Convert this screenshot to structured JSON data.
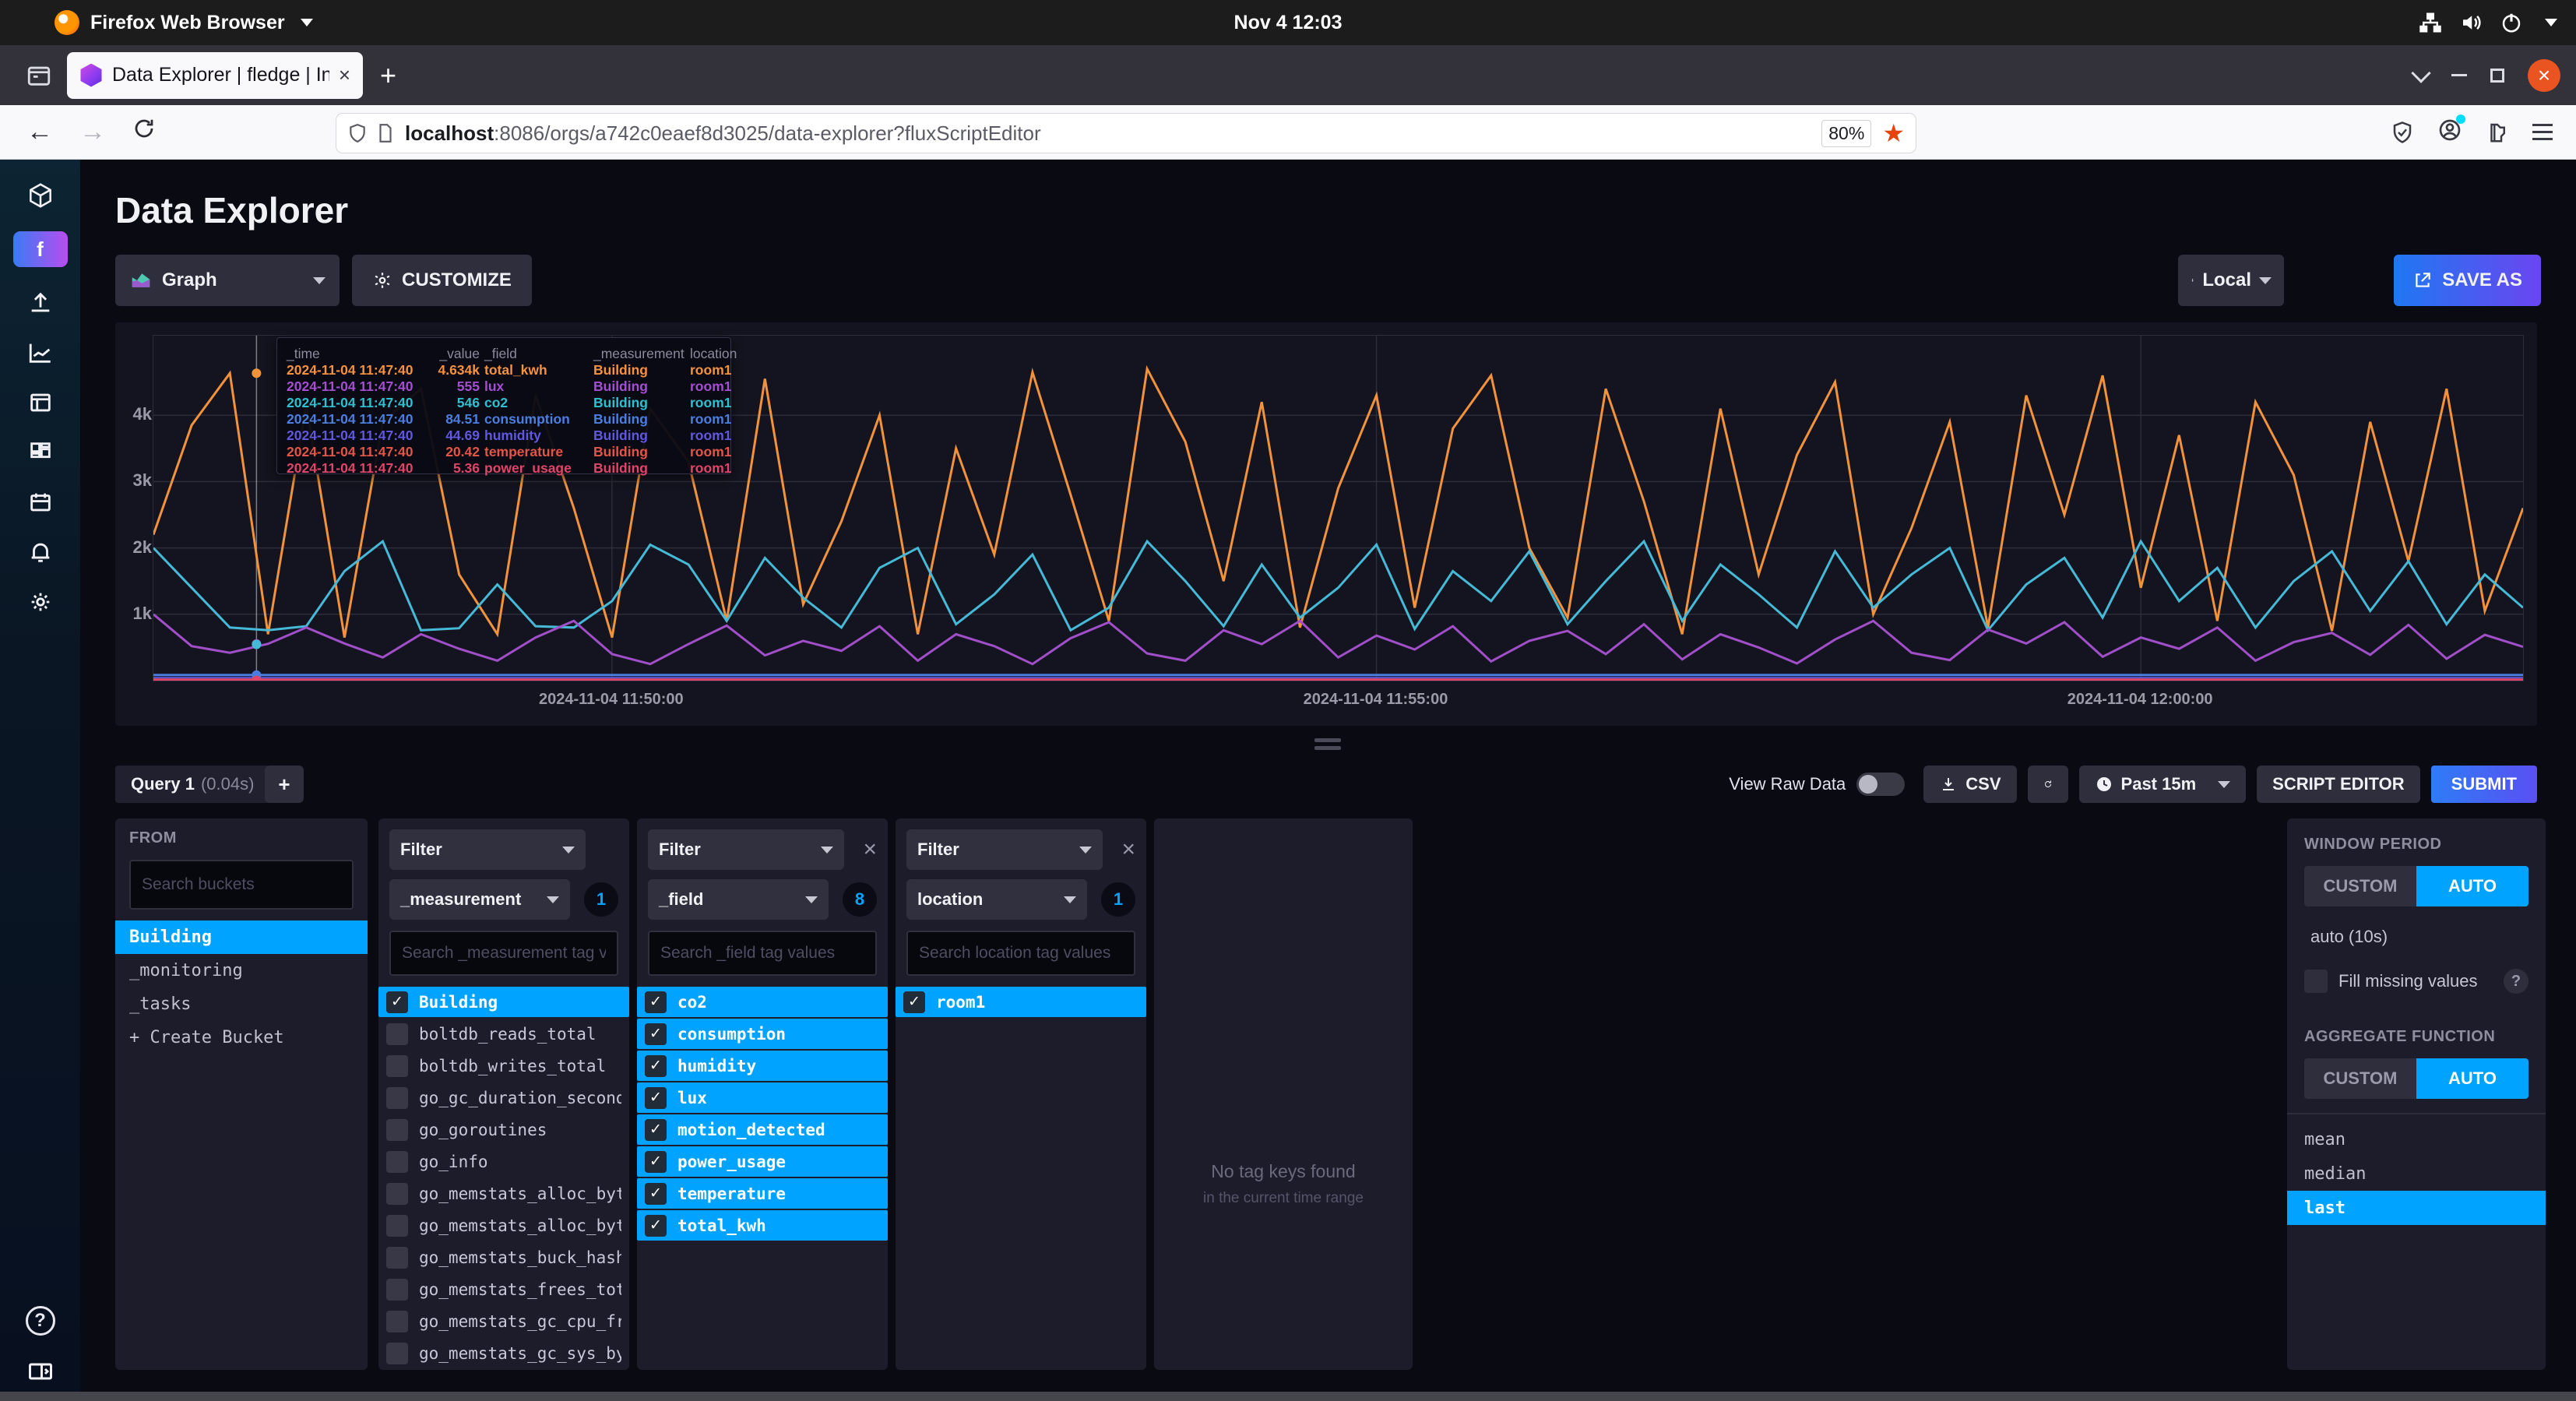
{
  "ubuntu_bar": {
    "app_menu": "Firefox Web Browser",
    "clock": "Nov 4 12:03"
  },
  "browser": {
    "tab_title": "Data Explorer | fledge | In",
    "tab_close": "×",
    "new_tab": "+",
    "close_btn": "×",
    "url_host": "localhost",
    "url_rest": ":8086/orgs/a742c0eaef8d3025/data-explorer?fluxScriptEditor",
    "zoom_level": "80%",
    "star": "★"
  },
  "sidebar": {
    "avatar_label": "f",
    "help_label": "?"
  },
  "header": {
    "title": "Data Explorer",
    "view_type": "Graph",
    "customize_label": "CUSTOMIZE",
    "local_label": "Local",
    "save_as_label": "SAVE AS"
  },
  "chart_data": {
    "type": "line",
    "title": "",
    "xlabel": "",
    "ylabel": "",
    "x_start": "2024-11-04 11:47:00",
    "x_end": "2024-11-04 12:02:30",
    "point_interval_s": 15,
    "ylim": [
      0,
      5200
    ],
    "grid": true,
    "legend": "none",
    "y_ticks": [
      {
        "label": "1k",
        "value": 1000
      },
      {
        "label": "2k",
        "value": 2000
      },
      {
        "label": "3k",
        "value": 3000
      },
      {
        "label": "4k",
        "value": 4000
      }
    ],
    "x_ticks": [
      {
        "label": "2024-11-04 11:50:00",
        "frac": 0.1935
      },
      {
        "label": "2024-11-04 11:55:00",
        "frac": 0.5161
      },
      {
        "label": "2024-11-04 12:00:00",
        "frac": 0.8387
      }
    ],
    "series": [
      {
        "name": "total_kwh",
        "color": "#f2933c",
        "values": [
          2200,
          3850,
          4634,
          700,
          4150,
          650,
          3900,
          4400,
          1600,
          700,
          4300,
          2600,
          650,
          4100,
          3300,
          900,
          4550,
          1150,
          2400,
          4000,
          700,
          3500,
          1900,
          4650,
          2800,
          900,
          4700,
          3600,
          1500,
          4200,
          800,
          2900,
          4300,
          1100,
          3800,
          4600,
          2000,
          950,
          4400,
          2700,
          700,
          4100,
          1600,
          3400,
          4500,
          1000,
          2300,
          3900,
          800,
          4300,
          2500,
          4600,
          1400,
          3700,
          900,
          4200,
          3100,
          750,
          3900,
          1800,
          4400,
          1050,
          2600
        ]
      },
      {
        "name": "co2",
        "color": "#45b9d6",
        "values": [
          2000,
          1400,
          800,
          760,
          820,
          1650,
          2100,
          760,
          790,
          1450,
          820,
          800,
          1200,
          2050,
          1750,
          900,
          1850,
          1250,
          800,
          1700,
          2000,
          850,
          1300,
          1900,
          760,
          1100,
          2100,
          1500,
          820,
          1750,
          950,
          1400,
          2050,
          780,
          1650,
          1200,
          1950,
          850,
          1500,
          2100,
          900,
          1750,
          1300,
          800,
          1950,
          1100,
          1600,
          2000,
          760,
          1450,
          1850,
          950,
          2100,
          1200,
          1700,
          800,
          1500,
          1950,
          1050,
          1800,
          850,
          1600,
          1100
        ]
      },
      {
        "name": "lux",
        "color": "#a14fc9",
        "values": [
          1000,
          520,
          420,
          555,
          800,
          560,
          350,
          700,
          480,
          300,
          650,
          900,
          400,
          250,
          550,
          830,
          380,
          600,
          450,
          820,
          300,
          700,
          520,
          250,
          640,
          880,
          410,
          300,
          760,
          550,
          900,
          350,
          680,
          470,
          820,
          290,
          600,
          750,
          400,
          850,
          320,
          700,
          500,
          260,
          620,
          900,
          420,
          310,
          770,
          560,
          880,
          360,
          650,
          480,
          800,
          300,
          580,
          720,
          390,
          840,
          330,
          690,
          510
        ]
      }
    ],
    "flat_series": [
      {
        "name": "consumption",
        "color": "#4a7de0",
        "value": 84.51,
        "width": 3
      },
      {
        "name": "humidity",
        "color": "#6158e0",
        "value": 44.69,
        "width": 2
      },
      {
        "name": "temperature",
        "color": "#e25648",
        "value": 20.42,
        "width": 2
      },
      {
        "name": "power_usage",
        "color": "#e04468",
        "value": 5.36,
        "width": 4
      }
    ],
    "crosshair": {
      "frac": 0.0435,
      "time": "2024-11-04 11:47:40",
      "markers": [
        {
          "value": 4634,
          "color": "#f2933c"
        },
        {
          "value": 555,
          "color": "#a14fc9"
        },
        {
          "value": 546,
          "color": "#45b9d6"
        },
        {
          "value": 84.51,
          "color": "#4a7de0"
        },
        {
          "value": 5.36,
          "color": "#e04468"
        }
      ]
    },
    "tooltip": {
      "headers": [
        "_time",
        "_value",
        "_field",
        "_measurement",
        "location"
      ],
      "rows": [
        {
          "time": "2024-11-04 11:47:40",
          "value": "4.634k",
          "field": "total_kwh",
          "measurement": "Building",
          "location": "room1",
          "color": "#f5913f"
        },
        {
          "time": "2024-11-04 11:47:40",
          "value": "555",
          "field": "lux",
          "measurement": "Building",
          "location": "room1",
          "color": "#a44fd0"
        },
        {
          "time": "2024-11-04 11:47:40",
          "value": "546",
          "field": "co2",
          "measurement": "Building",
          "location": "room1",
          "color": "#2fc0cf"
        },
        {
          "time": "2024-11-04 11:47:40",
          "value": "84.51",
          "field": "consumption",
          "measurement": "Building",
          "location": "room1",
          "color": "#4a7fe0"
        },
        {
          "time": "2024-11-04 11:47:40",
          "value": "44.69",
          "field": "humidity",
          "measurement": "Building",
          "location": "room1",
          "color": "#6158e0"
        },
        {
          "time": "2024-11-04 11:47:40",
          "value": "20.42",
          "field": "temperature",
          "measurement": "Building",
          "location": "room1",
          "color": "#e25648"
        },
        {
          "time": "2024-11-04 11:47:40",
          "value": "5.36",
          "field": "power_usage",
          "measurement": "Building",
          "location": "room1",
          "color": "#e04468"
        }
      ]
    }
  },
  "query_bar": {
    "tab_label": "Query 1",
    "tab_duration": "(0.04s)",
    "add_label": "+",
    "view_raw_label": "View Raw Data",
    "csv_label": "CSV",
    "time_range_label": "Past 15m",
    "script_editor_label": "SCRIPT EDITOR",
    "submit_label": "SUBMIT"
  },
  "builder": {
    "from": {
      "title": "FROM",
      "search_placeholder": "Search buckets",
      "buckets": [
        {
          "name": "Building",
          "selected": true
        },
        {
          "name": "_monitoring",
          "selected": false
        },
        {
          "name": "_tasks",
          "selected": false
        },
        {
          "name": "+ Create Bucket",
          "selected": false
        }
      ]
    },
    "filters": [
      {
        "title": "Filter",
        "key": "_measurement",
        "count": "1",
        "removable": false,
        "search_placeholder": "Search _measurement tag va",
        "items": [
          {
            "label": "Building",
            "checked": true
          },
          {
            "label": "boltdb_reads_total",
            "checked": false
          },
          {
            "label": "boltdb_writes_total",
            "checked": false
          },
          {
            "label": "go_gc_duration_seconds",
            "checked": false
          },
          {
            "label": "go_goroutines",
            "checked": false
          },
          {
            "label": "go_info",
            "checked": false
          },
          {
            "label": "go_memstats_alloc_byt…",
            "checked": false
          },
          {
            "label": "go_memstats_alloc_byt…",
            "checked": false
          },
          {
            "label": "go_memstats_buck_hash…",
            "checked": false
          },
          {
            "label": "go_memstats_frees_tot…",
            "checked": false
          },
          {
            "label": "go_memstats_gc_cpu_fr…",
            "checked": false
          },
          {
            "label": "go_memstats_gc_sys_by…",
            "checked": false
          }
        ]
      },
      {
        "title": "Filter",
        "key": "_field",
        "count": "8",
        "removable": true,
        "search_placeholder": "Search _field tag values",
        "items": [
          {
            "label": "co2",
            "checked": true
          },
          {
            "label": "consumption",
            "checked": true
          },
          {
            "label": "humidity",
            "checked": true
          },
          {
            "label": "lux",
            "checked": true
          },
          {
            "label": "motion_detected",
            "checked": true
          },
          {
            "label": "power_usage",
            "checked": true
          },
          {
            "label": "temperature",
            "checked": true
          },
          {
            "label": "total_kwh",
            "checked": true
          }
        ]
      },
      {
        "title": "Filter",
        "key": "location",
        "count": "1",
        "removable": true,
        "search_placeholder": "Search location tag values",
        "items": [
          {
            "label": "room1",
            "checked": true
          }
        ]
      }
    ],
    "empty_panel": {
      "line1": "No tag keys found",
      "line2": "in the current time range"
    },
    "window_period": {
      "title": "WINDOW PERIOD",
      "custom_label": "CUSTOM",
      "auto_label": "AUTO",
      "auto_value": "auto (10s)",
      "fill_label": "Fill missing values",
      "help_label": "?"
    },
    "aggregate": {
      "title": "AGGREGATE FUNCTION",
      "custom_label": "CUSTOM",
      "auto_label": "AUTO",
      "functions": [
        {
          "name": "mean",
          "selected": false
        },
        {
          "name": "median",
          "selected": false
        },
        {
          "name": "last",
          "selected": true
        }
      ]
    }
  }
}
